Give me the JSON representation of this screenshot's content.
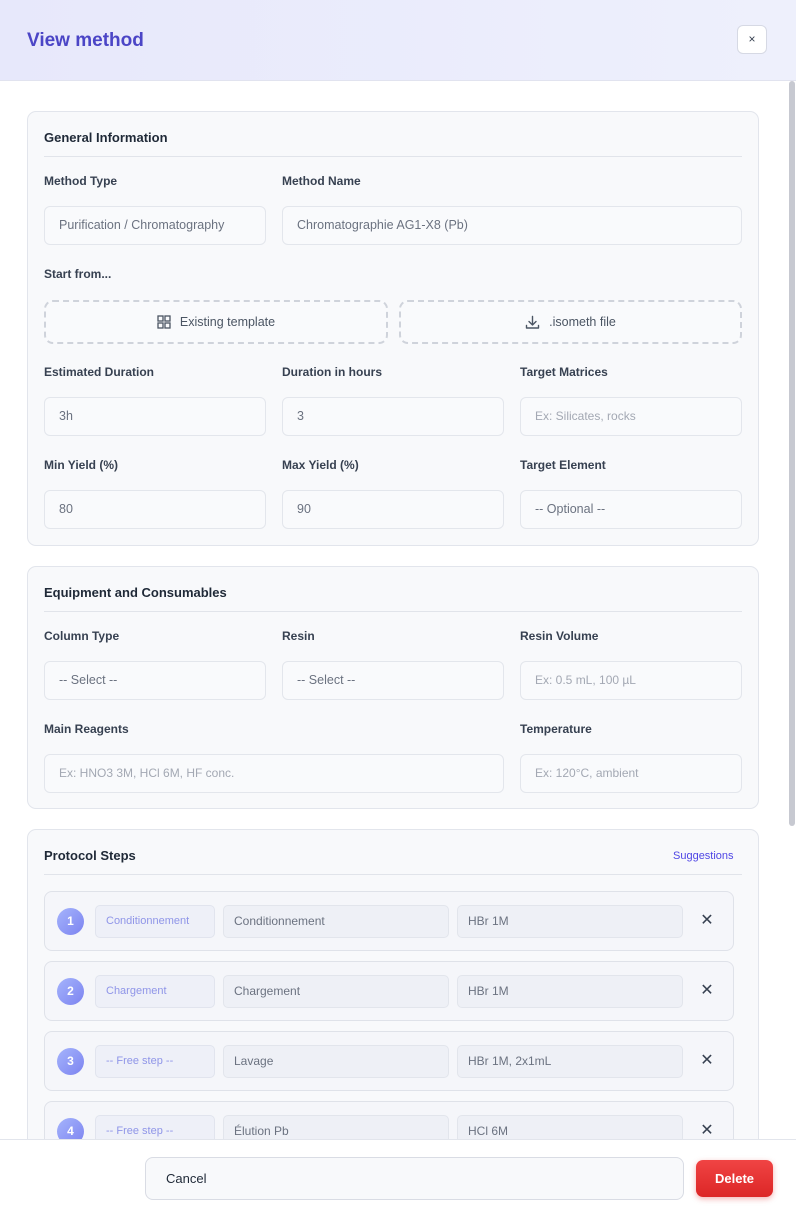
{
  "header": {
    "title": "View method",
    "close_label": "×"
  },
  "general": {
    "title": "General Information",
    "method_type_label": "Method Type",
    "method_type_value": "Purification / Chromatography",
    "method_name_label": "Method Name",
    "method_name_value": "Chromatographie AG1-X8 (Pb)",
    "start_from_label": "Start from...",
    "existing_template_label": "Existing template",
    "isometh_label": ".isometh file",
    "est_duration_label": "Estimated Duration",
    "est_duration_value": "3h",
    "duration_hours_label": "Duration in hours",
    "duration_hours_value": "3",
    "target_matrices_label": "Target Matrices",
    "target_matrices_placeholder": "Ex: Silicates, rocks",
    "min_yield_label": "Min Yield (%)",
    "min_yield_value": "80",
    "max_yield_label": "Max Yield (%)",
    "max_yield_value": "90",
    "target_element_label": "Target Element",
    "target_element_value": "-- Optional --"
  },
  "equipment": {
    "title": "Equipment and Consumables",
    "column_type_label": "Column Type",
    "column_type_value": "-- Select --",
    "resin_label": "Resin",
    "resin_value": "-- Select --",
    "resin_volume_label": "Resin Volume",
    "resin_volume_placeholder": "Ex: 0.5 mL, 100 µL",
    "main_reagents_label": "Main Reagents",
    "main_reagents_placeholder": "Ex: HNO3 3M, HCl 6M, HF conc.",
    "temperature_label": "Temperature",
    "temperature_placeholder": "Ex: 120°C, ambient"
  },
  "protocol": {
    "title": "Protocol Steps",
    "suggestions_label": "Suggestions",
    "remove_label": "✕",
    "steps": [
      {
        "num": "1",
        "type": "Conditionnement",
        "name": "Conditionnement",
        "reagent": "HBr 1M"
      },
      {
        "num": "2",
        "type": "Chargement",
        "name": "Chargement",
        "reagent": "HBr 1M"
      },
      {
        "num": "3",
        "type": "-- Free step --",
        "name": "Lavage",
        "reagent": "HBr 1M, 2x1mL"
      },
      {
        "num": "4",
        "type": "-- Free step --",
        "name": "Élution Pb",
        "reagent": "HCl 6M"
      }
    ]
  },
  "footer": {
    "cancel_label": "Cancel",
    "delete_label": "Delete"
  },
  "colors": {
    "accent": "#4b45c6",
    "danger": "#dc2626",
    "step_badge": "#7c83f0"
  }
}
